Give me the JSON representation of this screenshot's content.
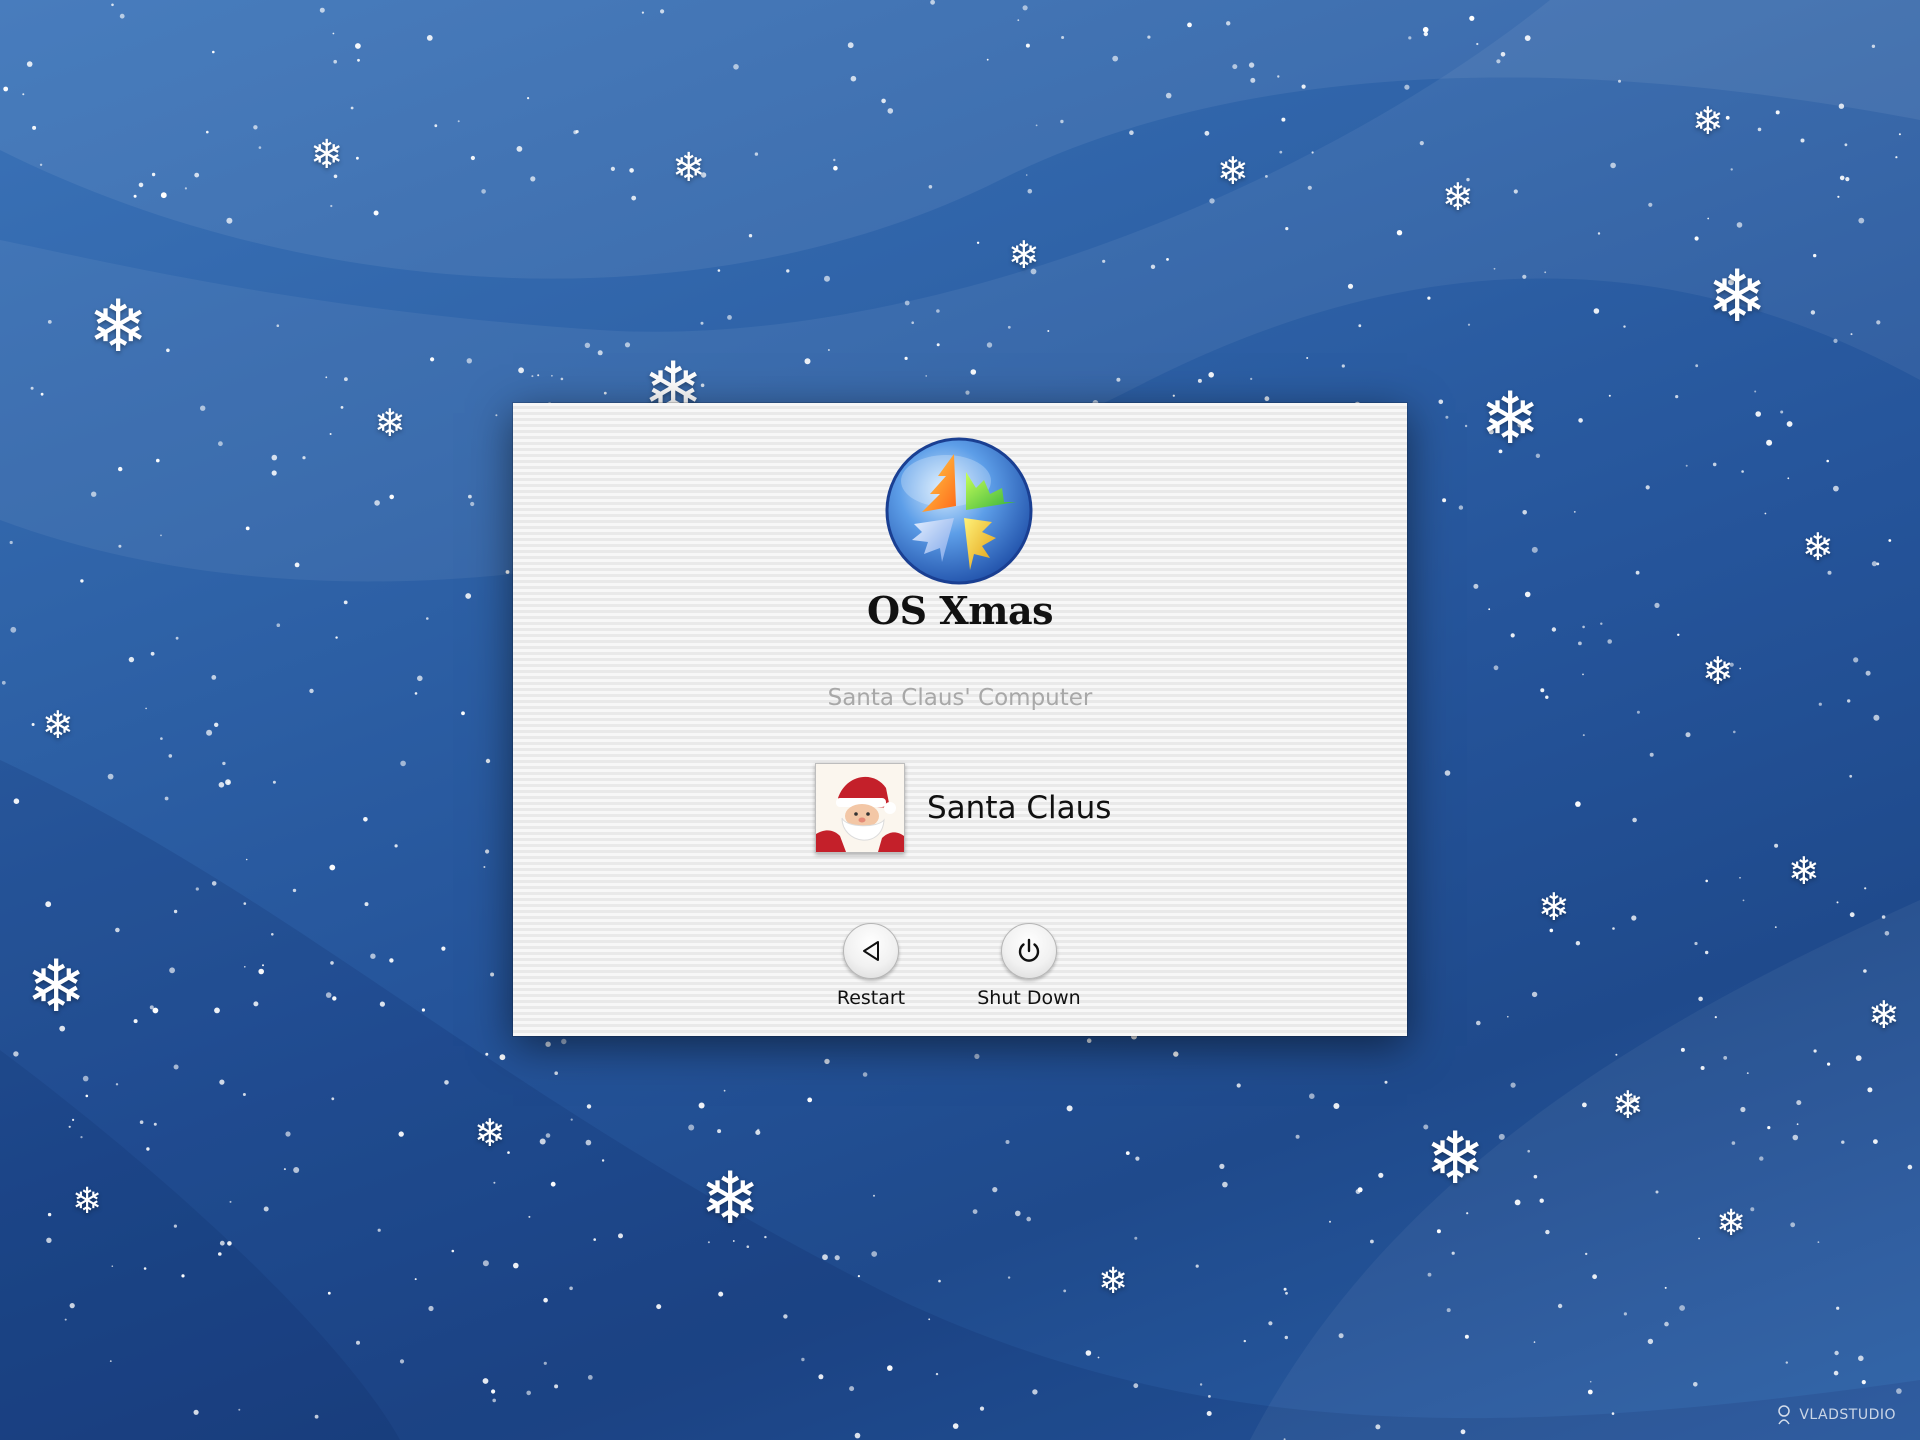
{
  "os": {
    "name": "OS Xmas",
    "logo_icon": "os-xmas-globe-logo"
  },
  "login": {
    "computer_name": "Santa Claus' Computer",
    "users": [
      {
        "name": "Santa Claus",
        "avatar_icon": "santa-avatar-icon"
      }
    ]
  },
  "controls": {
    "restart_label": "Restart",
    "restart_icon": "restart-triangle-icon",
    "shutdown_label": "Shut Down",
    "shutdown_icon": "power-icon"
  },
  "watermark": {
    "text": "VLADSTUDIO",
    "icon": "vladstudio-logo-icon"
  },
  "colors": {
    "desktop_blue": "#2f63a8",
    "panel_light": "#f7f7f7",
    "panel_stripe": "#e9e9e9",
    "computer_name_gray": "#a8a8a8"
  }
}
